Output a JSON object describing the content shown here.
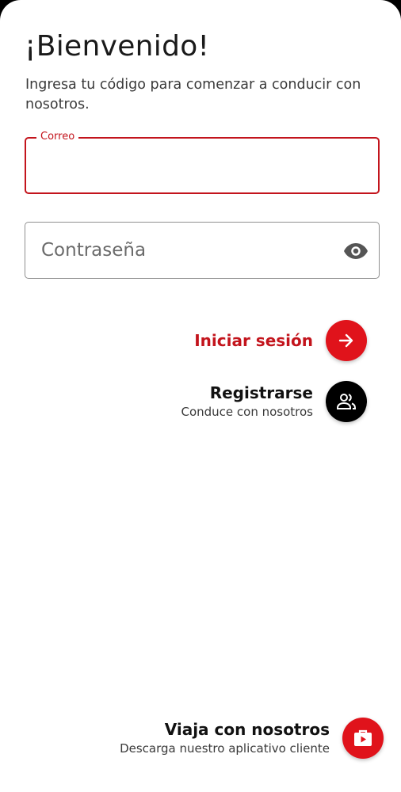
{
  "header": {
    "title": "¡Bienvenido!",
    "subtitle": "Ingresa tu código para comenzar a conducir con nosotros."
  },
  "form": {
    "email": {
      "label": "Correo",
      "value": "",
      "placeholder": ""
    },
    "password": {
      "value": "",
      "placeholder": "Contraseña",
      "visibility_icon": "eye-icon"
    }
  },
  "actions": {
    "login": {
      "label": "Iniciar sesión",
      "icon": "arrow-right-icon"
    },
    "register": {
      "label": "Registrarse",
      "sublabel": "Conduce con nosotros",
      "icon": "people-icon"
    },
    "travel": {
      "label": "Viaja con nosotros",
      "sublabel": "Descarga nuestro aplicativo cliente",
      "icon": "briefcase-play-icon"
    }
  },
  "colors": {
    "accent": "#c3141c",
    "dark": "#000000",
    "text": "#1a1a1a",
    "muted": "#3a3a3a"
  }
}
